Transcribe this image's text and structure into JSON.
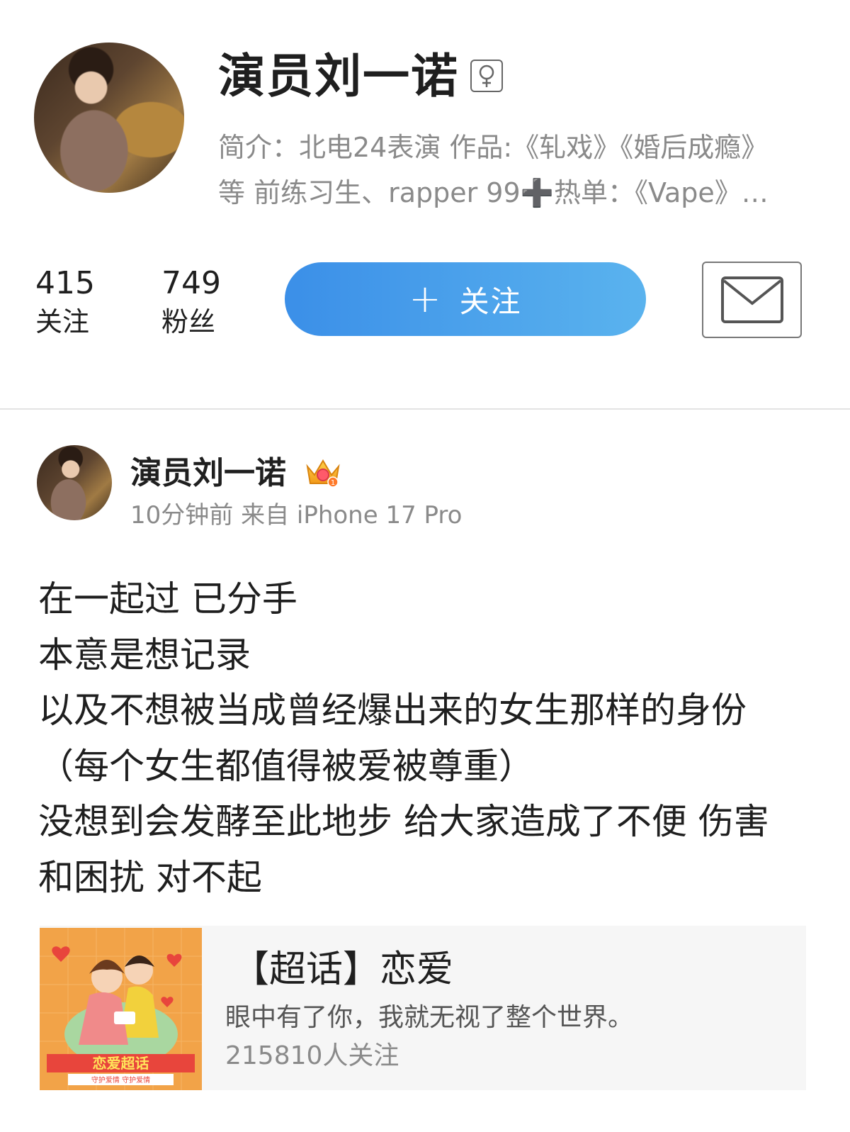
{
  "profile": {
    "name": "演员刘一诺",
    "gender_icon": "female-icon",
    "bio_line_1": "简介：北电24表演 作品:《轧戏》《婚后成瘾》",
    "bio_line_2": "等 前练习生、rapper 99➕热单：《Vape》…",
    "following_count": "415",
    "following_label": "关注",
    "fans_count": "749",
    "fans_label": "粉丝",
    "follow_button_icon": "+",
    "follow_button_label": "关注",
    "message_icon": "mail-icon"
  },
  "post": {
    "author": "演员刘一诺",
    "badge_icon": "crown-icon",
    "meta": "10分钟前 来自 iPhone 17 Pro",
    "lines": [
      "在一起过 已分手",
      "本意是想记录",
      "以及不想被当成曾经爆出来的女生那样的身份",
      "（每个女生都值得被爱被尊重）",
      "没想到会发酵至此地步 给大家造成了不便 伤害",
      "和困扰 对不起"
    ],
    "topic_card": {
      "title": "【超话】恋爱",
      "description": "眼中有了你，我就无视了整个世界。",
      "followers": "215810人关注",
      "thumb_caption": "恋爱超话",
      "thumb_subcaption": "守护爱情 守护爱情"
    }
  },
  "colors": {
    "follow_button_start": "#3b8fe8",
    "follow_button_end": "#5ab3ee",
    "muted_text": "#8a8a8a",
    "card_bg": "#f6f6f6",
    "divider": "#e3e3e3"
  }
}
